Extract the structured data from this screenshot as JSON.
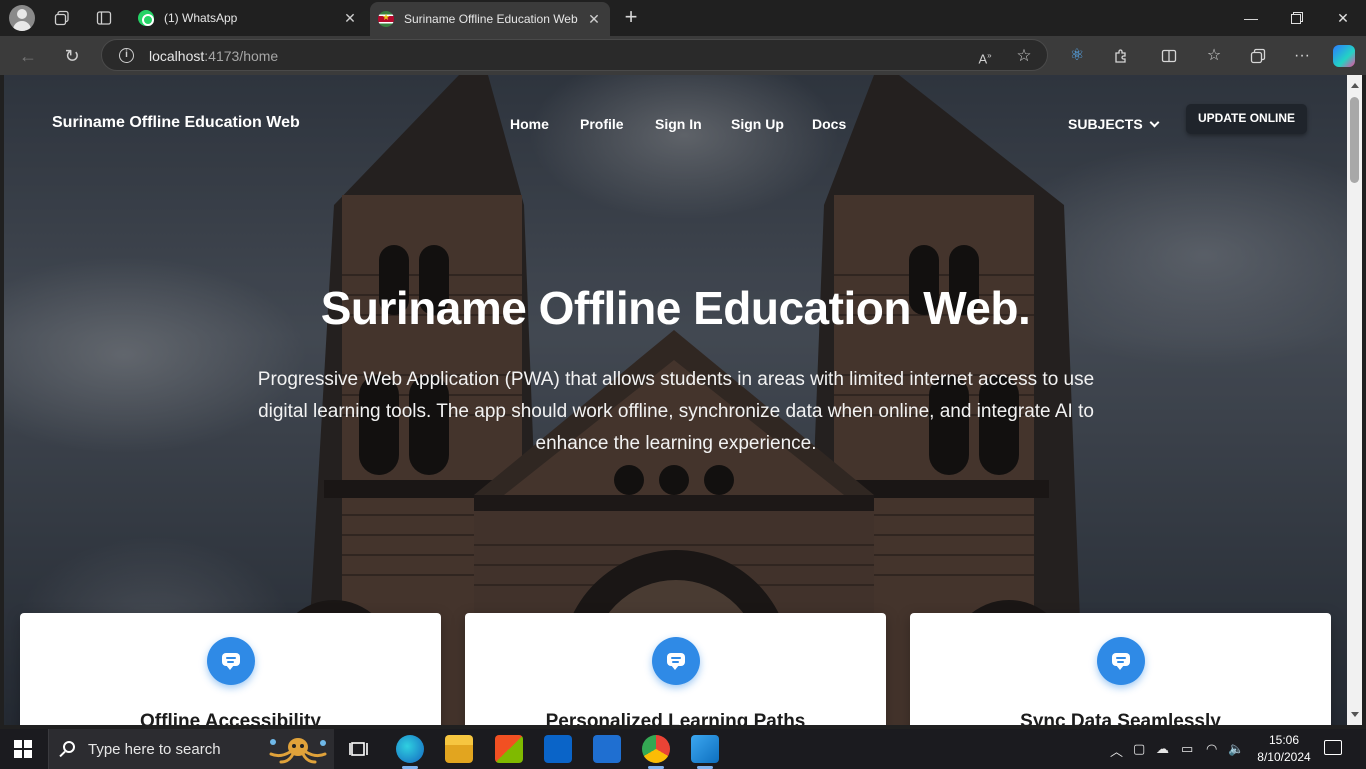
{
  "browser": {
    "tabs": [
      {
        "title": "(1) WhatsApp"
      },
      {
        "title": "Suriname Offline Education Web"
      }
    ],
    "address": {
      "host": "localhost",
      "rest": ":4173/home"
    }
  },
  "site": {
    "brand": "Suriname Offline Education Web",
    "nav": [
      "Home",
      "Profile",
      "Sign In",
      "Sign Up",
      "Docs"
    ],
    "subjects_label": "SUBJECTS",
    "update_button": "UPDATE ONLINE"
  },
  "hero": {
    "title": "Suriname Offline Education Web.",
    "subtitle": "Progressive Web Application (PWA) that allows students in areas with limited internet access to use digital learning tools. The app should work offline, synchronize data when online, and integrate AI to enhance the learning experience."
  },
  "features": [
    {
      "title": "Offline Accessibility",
      "icon": "chat-icon"
    },
    {
      "title": "Personalized Learning Paths",
      "icon": "chat-icon"
    },
    {
      "title": "Sync Data Seamlessly",
      "icon": "chat-icon"
    }
  ],
  "taskbar": {
    "search_placeholder": "Type here to search",
    "time": "15:06",
    "date": "8/10/2024"
  },
  "colors": {
    "accent": "#2f8ae6",
    "update_button_bg": "#1f242b",
    "browser_chrome": "#202020"
  }
}
